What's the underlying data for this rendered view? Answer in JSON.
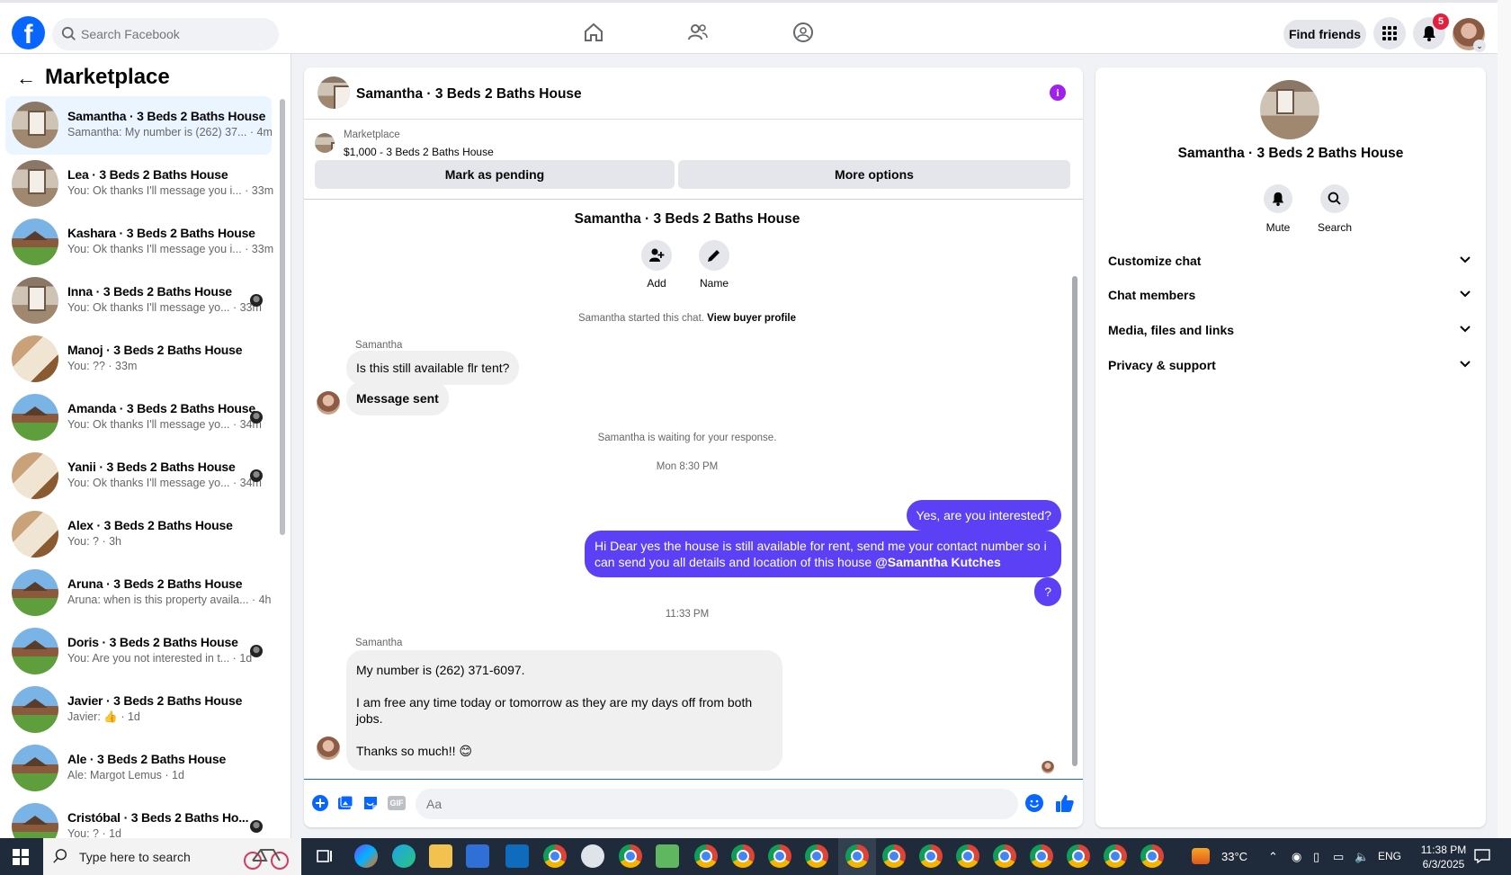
{
  "topbar": {
    "logo_letter": "f",
    "search_placeholder": "Search Facebook",
    "find_friends_label": "Find friends",
    "notification_count": "5"
  },
  "sidebar": {
    "back_arrow": "←",
    "title": "Marketplace",
    "conversations": [
      {
        "name": "Samantha · 3 Beds 2 Baths House",
        "preview": "Samantha: My number is (262) 37... · 4m",
        "thumb": "room",
        "active": true,
        "dot": false
      },
      {
        "name": "Lea · 3 Beds 2 Baths House",
        "preview": "You: Ok thanks I'll message you i... · 33m",
        "thumb": "room",
        "active": false,
        "dot": false
      },
      {
        "name": "Kashara · 3 Beds 2 Baths House",
        "preview": "You: Ok thanks I'll message you i... · 33m",
        "thumb": "house",
        "active": false,
        "dot": false
      },
      {
        "name": "Inna · 3 Beds 2 Baths House",
        "preview": "You: Ok thanks I'll message yo... · 33m",
        "thumb": "room",
        "active": false,
        "dot": true
      },
      {
        "name": "Manoj · 3 Beds 2 Baths House",
        "preview": "You: ?? · 33m",
        "thumb": "interior",
        "active": false,
        "dot": false
      },
      {
        "name": "Amanda · 3 Beds 2 Baths House",
        "preview": "You: Ok thanks I'll message yo... · 34m",
        "thumb": "house",
        "active": false,
        "dot": true
      },
      {
        "name": "Yanii · 3 Beds 2 Baths House",
        "preview": "You: Ok thanks I'll message yo... · 34m",
        "thumb": "interior",
        "active": false,
        "dot": true
      },
      {
        "name": "Alex · 3 Beds 2 Baths House",
        "preview": "You: ? · 3h",
        "thumb": "interior",
        "active": false,
        "dot": false
      },
      {
        "name": "Aruna · 3 Beds 2 Baths House",
        "preview": "Aruna: when is this property availa... · 4h",
        "thumb": "house",
        "active": false,
        "dot": false
      },
      {
        "name": "Doris · 3 Beds 2 Baths House",
        "preview": "You: Are you not interested in t... · 1d",
        "thumb": "house",
        "active": false,
        "dot": true
      },
      {
        "name": "Javier · 3 Beds 2 Baths House",
        "preview": "Javier: 👍 · 1d",
        "thumb": "house",
        "active": false,
        "dot": false
      },
      {
        "name": "Ale · 3 Beds 2 Baths House",
        "preview": "Ale: Margot Lemus · 1d",
        "thumb": "house",
        "active": false,
        "dot": false
      },
      {
        "name": "Cristóbal · 3 Beds 2 Baths Ho...",
        "preview": "You: ? · 1d",
        "thumb": "house",
        "active": false,
        "dot": true
      }
    ]
  },
  "chat": {
    "title": "Samantha · 3 Beds 2 Baths House",
    "info_glyph": "i",
    "listing_label": "Marketplace",
    "listing_price": "$1,000 - 3 Beds 2 Baths House",
    "mark_pending_label": "Mark as pending",
    "more_options_label": "More options",
    "intro_name": "Samantha · 3 Beds 2 Baths House",
    "add_label": "Add",
    "name_label": "Name",
    "started_text": "Samantha started this chat.",
    "view_buyer_label": "View buyer profile",
    "sender_1": "Samantha",
    "msg_in_1": "Is this still available flr tent?",
    "msg_in_2": "Message sent",
    "waiting_text": "Samantha is waiting for your response.",
    "time_1": "Mon 8:30 PM",
    "msg_out_1": "Yes, are you interested?",
    "msg_out_2": "Hi Dear yes the house is still available for rent, send me your contact number so i can send you all details and location of this house",
    "msg_out_2_mention": "@Samantha Kutches",
    "msg_out_3": "?",
    "time_2": "11:33 PM",
    "sender_2": "Samantha",
    "msg_in_3_line1": "My number is (262) 371-6097.",
    "msg_in_3_line2": "I am free any time today or tomorrow as they are my days off from both jobs.",
    "msg_in_3_line3": "Thanks so much!! 😊",
    "composer_placeholder": "Aa",
    "gif_label": "GIF"
  },
  "info_panel": {
    "name": "Samantha · 3 Beds 2 Baths House",
    "mute_label": "Mute",
    "search_label": "Search",
    "sections": [
      "Customize chat",
      "Chat members",
      "Media, files and links",
      "Privacy & support"
    ]
  },
  "taskbar": {
    "search_placeholder": "Type here to search",
    "temperature": "33°C",
    "language": "ENG",
    "time": "11:38 PM",
    "date": "6/3/2025"
  },
  "colors": {
    "brand": "#0866ff",
    "outgoing_bubble": "#5b40f6",
    "incoming_bubble": "#f0f0f0",
    "info_icon": "#a020f0",
    "badge": "#e41e3f"
  },
  "icons": [
    "search-icon",
    "home-icon",
    "friends-icon",
    "groups-icon",
    "menu-grid-icon",
    "bell-icon",
    "info-icon",
    "add-person-icon",
    "pencil-icon",
    "plus-icon",
    "image-icon",
    "sticker-icon",
    "gif-icon",
    "emoji-icon",
    "thumbs-up-icon",
    "chevron-down-icon"
  ]
}
